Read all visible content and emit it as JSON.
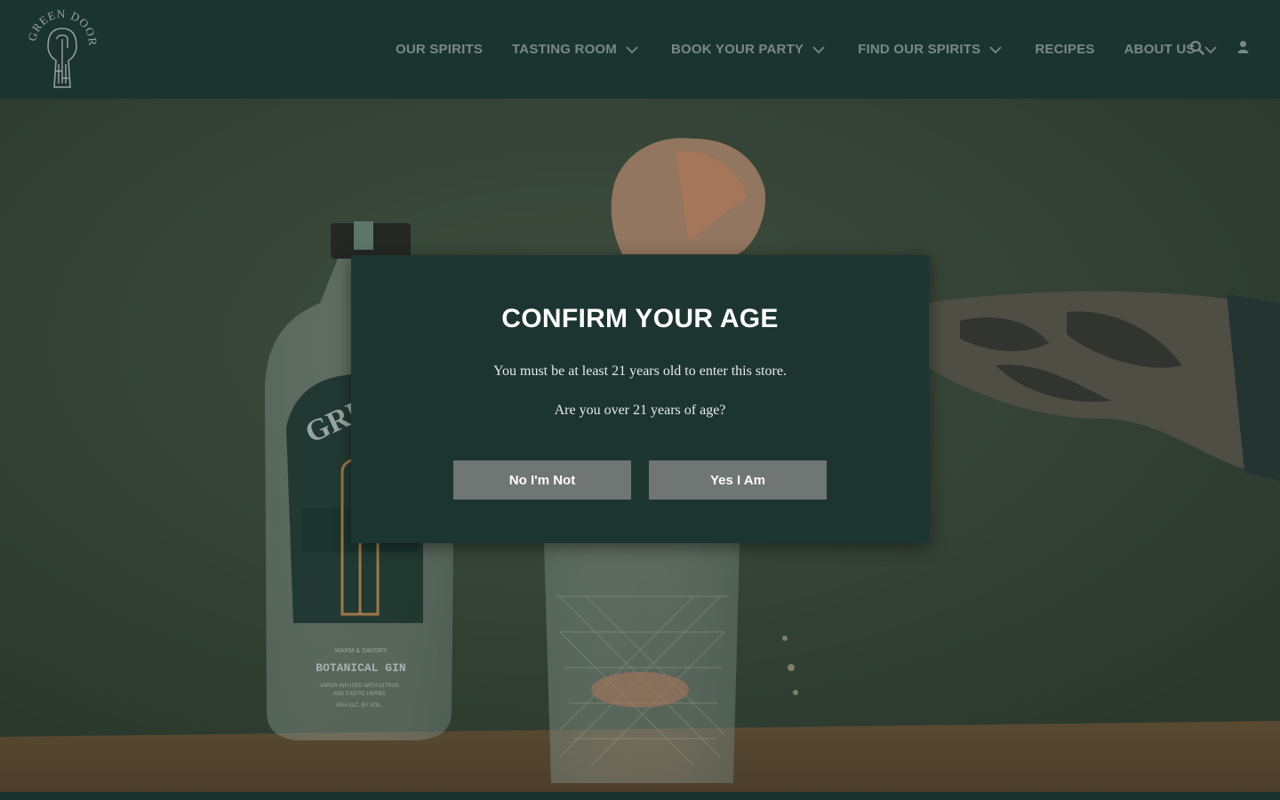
{
  "brand": {
    "logo_text": "GREEN DOOR"
  },
  "nav": {
    "items": [
      {
        "label": "OUR SPIRITS",
        "has_dropdown": false
      },
      {
        "label": "TASTING ROOM",
        "has_dropdown": true
      },
      {
        "label": "BOOK YOUR PARTY",
        "has_dropdown": true
      },
      {
        "label": "FIND OUR SPIRITS",
        "has_dropdown": true
      },
      {
        "label": "RECIPES",
        "has_dropdown": false
      },
      {
        "label": "ABOUT US",
        "has_dropdown": true
      }
    ],
    "icons": [
      "search-icon",
      "user-icon"
    ]
  },
  "hero": {
    "bottle_label_line1": "WARM & SAVORY",
    "bottle_label_line2": "BOTANICAL GIN",
    "bottle_label_line3": "VAPOR INFUSED WITH CITRUS",
    "bottle_label_line4": "AND EXOTIC HERBS",
    "bottle_label_line5": "45% ALC. BY VOL.",
    "bottle_brand": "GREEN"
  },
  "age_modal": {
    "title": "CONFIRM YOUR AGE",
    "message": "You must be at least 21 years old to enter this store.",
    "question": "Are you over 21 years of age?",
    "decline_label": "No I'm Not",
    "accept_label": "Yes I Am"
  },
  "colors": {
    "header_bg": "#1f3a33",
    "modal_bg": "#1d3530",
    "nav_text": "#8fa39b",
    "button_bg": "#6f7674"
  }
}
